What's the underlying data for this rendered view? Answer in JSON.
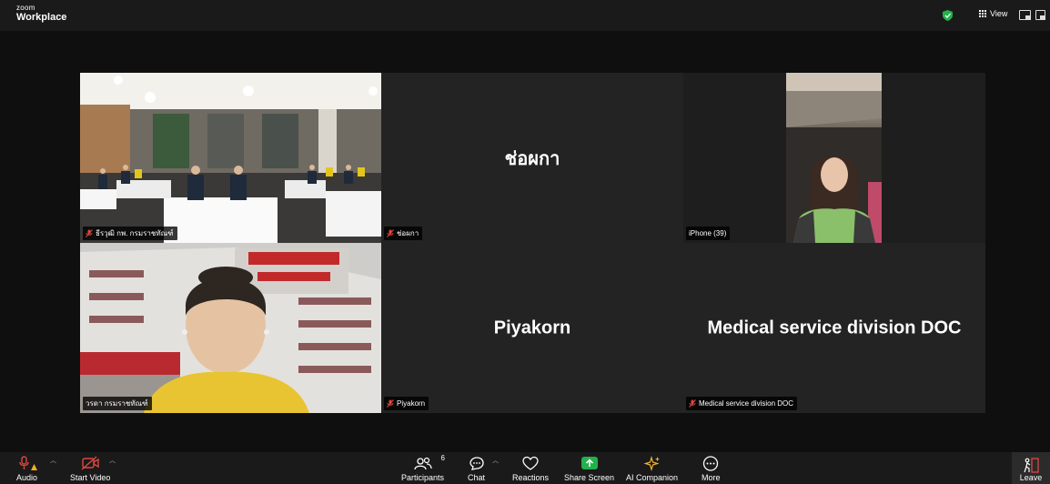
{
  "window": {
    "logo_line1": "zoom",
    "logo_line2": "Workplace"
  },
  "topbar": {
    "view_label": "View"
  },
  "tiles": {
    "room": {
      "tag": "ธีรวุฒิ กพ. กรมราชทัณฑ์"
    },
    "chompka": {
      "big": "ช่อผกา",
      "tag": "ช่อผกา"
    },
    "iphone": {
      "tag": "iPhone (39)"
    },
    "worada": {
      "tag": "วรดา กรมราชทัณฑ์"
    },
    "piyakorn": {
      "big": "Piyakorn",
      "tag": "Piyakorn"
    },
    "medical": {
      "big": "Medical service division DOC",
      "tag": "Medical service division DOC"
    }
  },
  "toolbar": {
    "audio": "Audio",
    "start_video": "Start Video",
    "participants": "Participants",
    "participant_count": "6",
    "chat": "Chat",
    "reactions": "Reactions",
    "share_screen": "Share Screen",
    "ai_companion": "AI Companion",
    "more": "More",
    "leave": "Leave"
  },
  "colors": {
    "accent_green": "#21b24b",
    "mute_red": "#e0463f",
    "leave_red": "#e0463f"
  }
}
